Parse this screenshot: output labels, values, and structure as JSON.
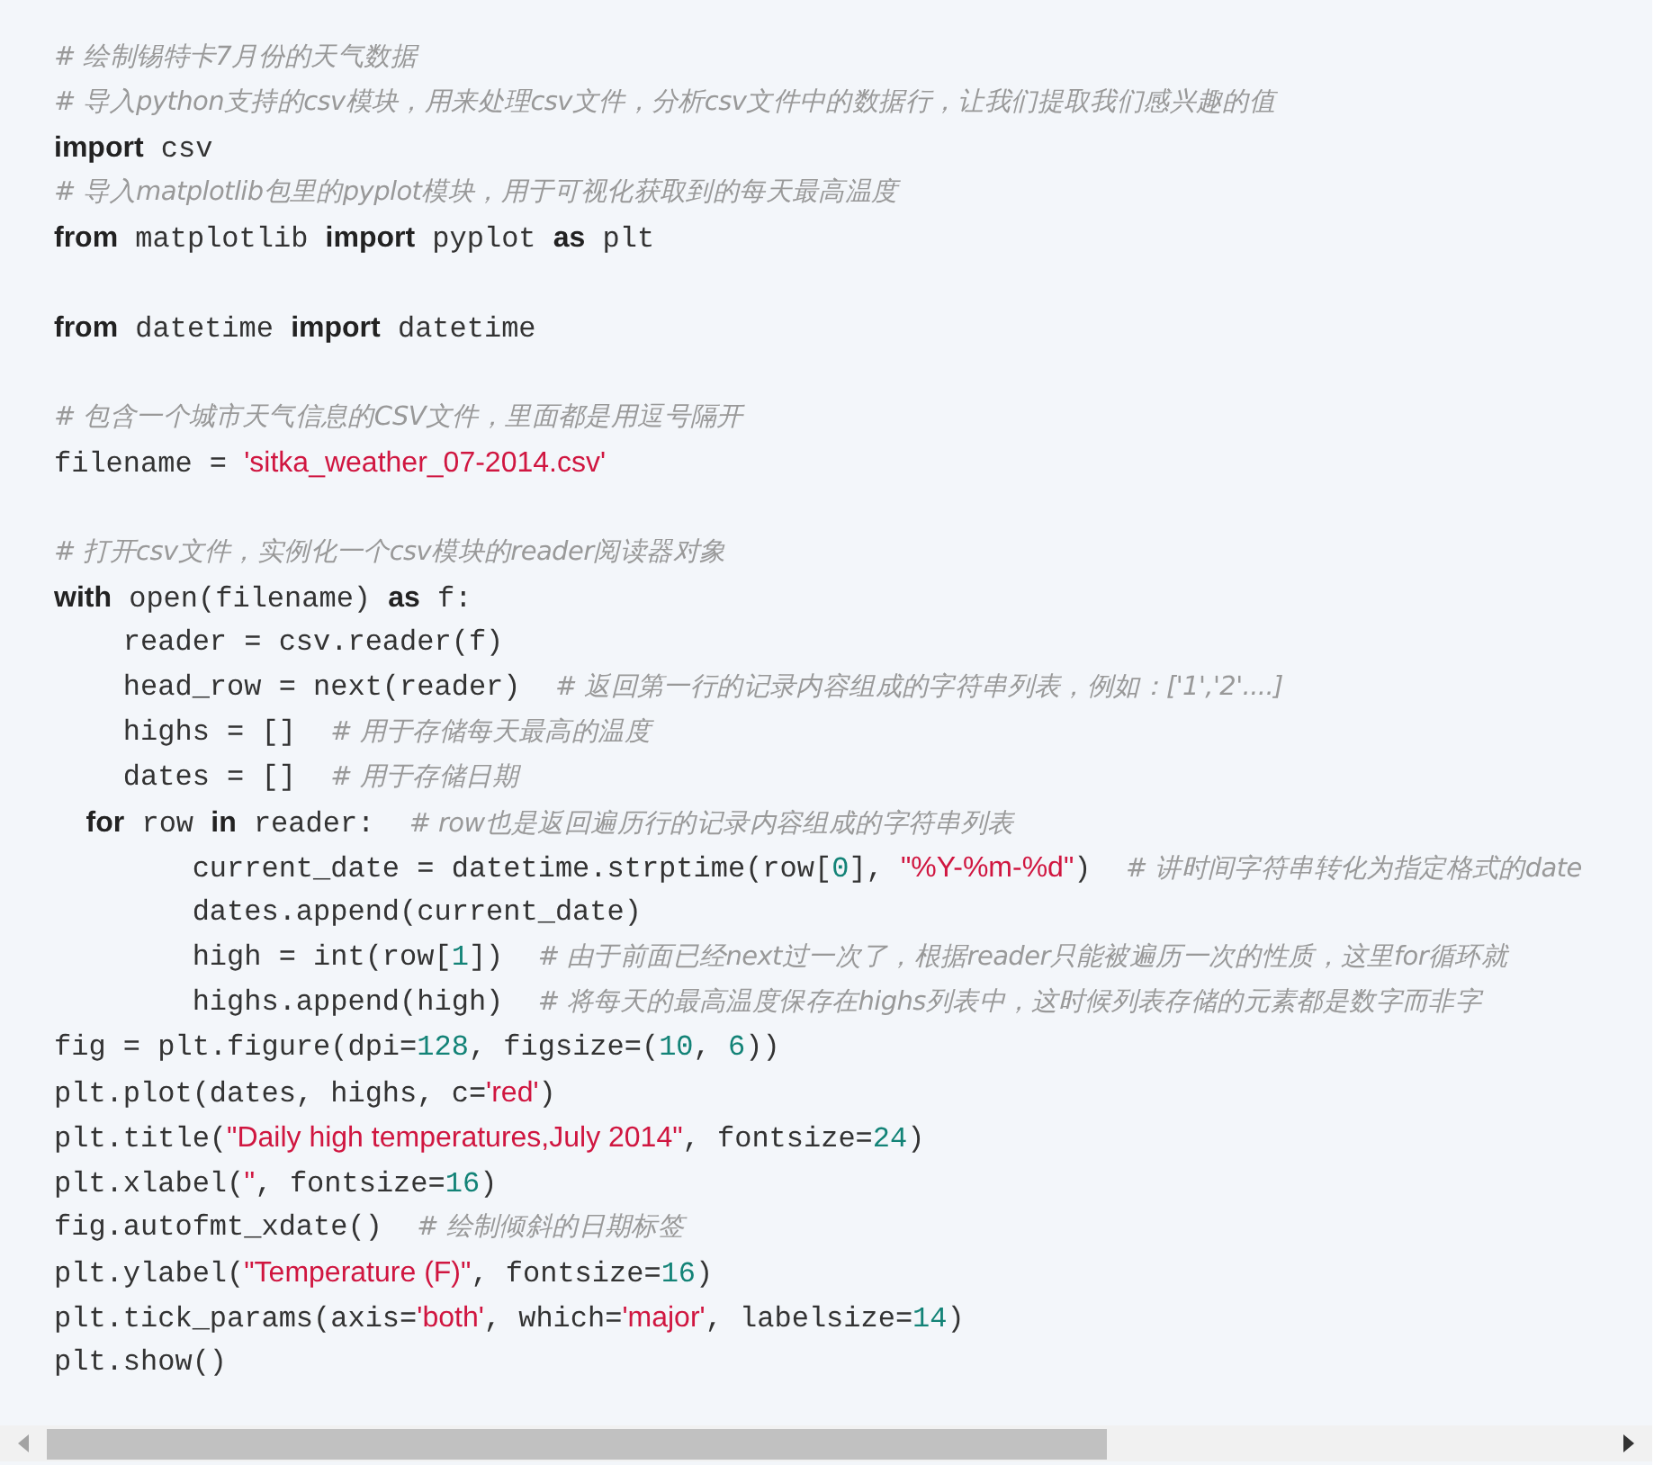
{
  "code_lines": [
    {
      "kind": "code",
      "tokens": [
        {
          "kind": "comment",
          "text": "# 绘制锡特卡7月份的天气数据"
        }
      ]
    },
    {
      "kind": "code",
      "tokens": [
        {
          "kind": "comment",
          "text": "# 导入python支持的csv模块，用来处理csv文件，分析csv文件中的数据行，让我们提取我们感兴趣的值"
        }
      ]
    },
    {
      "kind": "code",
      "tokens": [
        {
          "kind": "keyword",
          "text": "import"
        },
        {
          "kind": "plain",
          "text": " csv"
        }
      ]
    },
    {
      "kind": "code",
      "tokens": [
        {
          "kind": "comment",
          "text": "# 导入matplotlib包里的pyplot模块，用于可视化获取到的每天最高温度"
        }
      ]
    },
    {
      "kind": "code",
      "tokens": [
        {
          "kind": "keyword",
          "text": "from"
        },
        {
          "kind": "plain",
          "text": " matplotlib "
        },
        {
          "kind": "keyword",
          "text": "import"
        },
        {
          "kind": "plain",
          "text": " pyplot "
        },
        {
          "kind": "keyword",
          "text": "as"
        },
        {
          "kind": "plain",
          "text": " plt"
        }
      ]
    },
    {
      "kind": "blank"
    },
    {
      "kind": "code",
      "tokens": [
        {
          "kind": "keyword",
          "text": "from"
        },
        {
          "kind": "plain",
          "text": " datetime "
        },
        {
          "kind": "keyword",
          "text": "import"
        },
        {
          "kind": "plain",
          "text": " datetime"
        }
      ]
    },
    {
      "kind": "blank"
    },
    {
      "kind": "code",
      "tokens": [
        {
          "kind": "comment",
          "text": "# 包含一个城市天气信息的CSV文件，里面都是用逗号隔开"
        }
      ]
    },
    {
      "kind": "code",
      "tokens": [
        {
          "kind": "plain",
          "text": "filename = "
        },
        {
          "kind": "string",
          "text": "'sitka_weather_07-2014.csv'"
        }
      ]
    },
    {
      "kind": "blank"
    },
    {
      "kind": "code",
      "tokens": [
        {
          "kind": "comment",
          "text": "# 打开csv文件，实例化一个csv模块的reader阅读器对象"
        }
      ]
    },
    {
      "kind": "code",
      "tokens": [
        {
          "kind": "keyword",
          "text": "with"
        },
        {
          "kind": "plain",
          "text": " open(filename) "
        },
        {
          "kind": "keyword",
          "text": "as"
        },
        {
          "kind": "plain",
          "text": " f:"
        }
      ]
    },
    {
      "kind": "code",
      "tokens": [
        {
          "kind": "plain",
          "text": "    reader = csv.reader(f)"
        }
      ]
    },
    {
      "kind": "code",
      "tokens": [
        {
          "kind": "plain",
          "text": "    head_row = next(reader)  "
        },
        {
          "kind": "comment",
          "text": "# 返回第一行的记录内容组成的字符串列表，例如：['1','2'....]"
        }
      ]
    },
    {
      "kind": "code",
      "tokens": [
        {
          "kind": "plain",
          "text": "    highs = []  "
        },
        {
          "kind": "comment",
          "text": "# 用于存储每天最高的温度"
        }
      ]
    },
    {
      "kind": "code",
      "tokens": [
        {
          "kind": "plain",
          "text": "    dates = []  "
        },
        {
          "kind": "comment",
          "text": "# 用于存储日期"
        }
      ]
    },
    {
      "kind": "code",
      "tokens": [
        {
          "kind": "keyword",
          "text": "    for"
        },
        {
          "kind": "plain",
          "text": " row "
        },
        {
          "kind": "keyword",
          "text": "in"
        },
        {
          "kind": "plain",
          "text": " reader:  "
        },
        {
          "kind": "comment",
          "text": "# row也是返回遍历行的记录内容组成的字符串列表"
        }
      ]
    },
    {
      "kind": "code",
      "tokens": [
        {
          "kind": "plain",
          "text": "        current_date = datetime.strptime(row["
        },
        {
          "kind": "number",
          "text": "0"
        },
        {
          "kind": "plain",
          "text": "], "
        },
        {
          "kind": "string",
          "text": "\"%Y-%m-%d\""
        },
        {
          "kind": "plain",
          "text": ")  "
        },
        {
          "kind": "comment",
          "text": "# 讲时间字符串转化为指定格式的date"
        }
      ]
    },
    {
      "kind": "code",
      "tokens": [
        {
          "kind": "plain",
          "text": "        dates.append(current_date)"
        }
      ]
    },
    {
      "kind": "code",
      "tokens": [
        {
          "kind": "plain",
          "text": "        high = int(row["
        },
        {
          "kind": "number",
          "text": "1"
        },
        {
          "kind": "plain",
          "text": "])  "
        },
        {
          "kind": "comment",
          "text": "# 由于前面已经next过一次了，根据reader只能被遍历一次的性质，这里for循环就"
        }
      ]
    },
    {
      "kind": "code",
      "tokens": [
        {
          "kind": "plain",
          "text": "        highs.append(high)  "
        },
        {
          "kind": "comment",
          "text": "# 将每天的最高温度保存在highs列表中，这时候列表存储的元素都是数字而非字"
        }
      ]
    },
    {
      "kind": "code",
      "tokens": [
        {
          "kind": "plain",
          "text": "fig = plt.figure(dpi="
        },
        {
          "kind": "number",
          "text": "128"
        },
        {
          "kind": "plain",
          "text": ", figsize=("
        },
        {
          "kind": "number",
          "text": "10"
        },
        {
          "kind": "plain",
          "text": ", "
        },
        {
          "kind": "number",
          "text": "6"
        },
        {
          "kind": "plain",
          "text": "))"
        }
      ]
    },
    {
      "kind": "code",
      "tokens": [
        {
          "kind": "plain",
          "text": "plt.plot(dates, highs, c="
        },
        {
          "kind": "string",
          "text": "'red'"
        },
        {
          "kind": "plain",
          "text": ")"
        }
      ]
    },
    {
      "kind": "code",
      "tokens": [
        {
          "kind": "plain",
          "text": "plt.title("
        },
        {
          "kind": "string",
          "text": "\"Daily high temperatures,July 2014\""
        },
        {
          "kind": "plain",
          "text": ", fontsize="
        },
        {
          "kind": "number",
          "text": "24"
        },
        {
          "kind": "plain",
          "text": ")"
        }
      ]
    },
    {
      "kind": "code",
      "tokens": [
        {
          "kind": "plain",
          "text": "plt.xlabel("
        },
        {
          "kind": "string",
          "text": "''"
        },
        {
          "kind": "plain",
          "text": ", fontsize="
        },
        {
          "kind": "number",
          "text": "16"
        },
        {
          "kind": "plain",
          "text": ")"
        }
      ]
    },
    {
      "kind": "code",
      "tokens": [
        {
          "kind": "plain",
          "text": "fig.autofmt_xdate()  "
        },
        {
          "kind": "comment",
          "text": "# 绘制倾斜的日期标签"
        }
      ]
    },
    {
      "kind": "code",
      "tokens": [
        {
          "kind": "plain",
          "text": "plt.ylabel("
        },
        {
          "kind": "string",
          "text": "\"Temperature (F)\""
        },
        {
          "kind": "plain",
          "text": ", fontsize="
        },
        {
          "kind": "number",
          "text": "16"
        },
        {
          "kind": "plain",
          "text": ")"
        }
      ]
    },
    {
      "kind": "code",
      "tokens": [
        {
          "kind": "plain",
          "text": "plt.tick_params(axis="
        },
        {
          "kind": "string",
          "text": "'both'"
        },
        {
          "kind": "plain",
          "text": ", which="
        },
        {
          "kind": "string",
          "text": "'major'"
        },
        {
          "kind": "plain",
          "text": ", labelsize="
        },
        {
          "kind": "number",
          "text": "14"
        },
        {
          "kind": "plain",
          "text": ")"
        }
      ]
    },
    {
      "kind": "code",
      "tokens": [
        {
          "kind": "plain",
          "text": "plt.show()"
        }
      ]
    }
  ]
}
